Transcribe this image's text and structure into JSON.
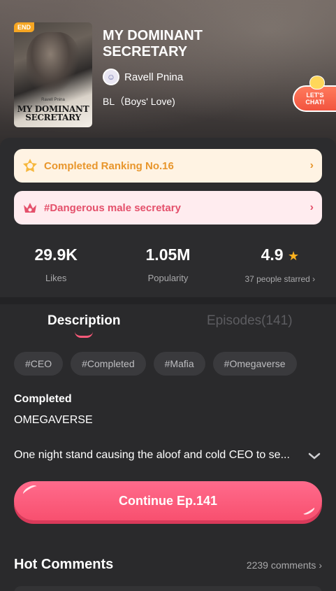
{
  "comic": {
    "status_tag": "END",
    "cover_author": "Ravell Pnina",
    "cover_title": "MY DOMINANT SECRETARY",
    "title": "MY DOMINANT SECRETARY",
    "author": "Ravell Pnina",
    "genre": "BL（Boys' Love)"
  },
  "chat_badge": {
    "line1": "LET'S",
    "line2": "CHAT!"
  },
  "ranking_pill": {
    "label": "Completed Ranking No.16",
    "chevron": "›",
    "icon": "medal-icon"
  },
  "tag_pill": {
    "label": "#Dangerous male secretary",
    "chevron": "›",
    "icon": "crown-icon"
  },
  "stats": {
    "likes_value": "29.9K",
    "likes_label": "Likes",
    "popularity_value": "1.05M",
    "popularity_label": "Popularity",
    "rating_value": "4.9",
    "rating_label": "37 people starred ›"
  },
  "tabs": {
    "description": "Description",
    "episodes": "Episodes(141)"
  },
  "tags": [
    "#CEO",
    "#Completed",
    "#Mafia",
    "#Omegaverse"
  ],
  "description": {
    "status": "Completed",
    "subgenre": "OMEGAVERSE",
    "synopsis": "One night stand causing the aloof and cold CEO to se..."
  },
  "continue_button": {
    "label": "Continue Ep.141"
  },
  "hot_comments": {
    "title": "Hot Comments",
    "count": "2239 comments ›"
  },
  "colors": {
    "accent": "#f8506f",
    "rank": "#e8962c",
    "tag": "#e4506b",
    "star": "#ffb21e"
  }
}
